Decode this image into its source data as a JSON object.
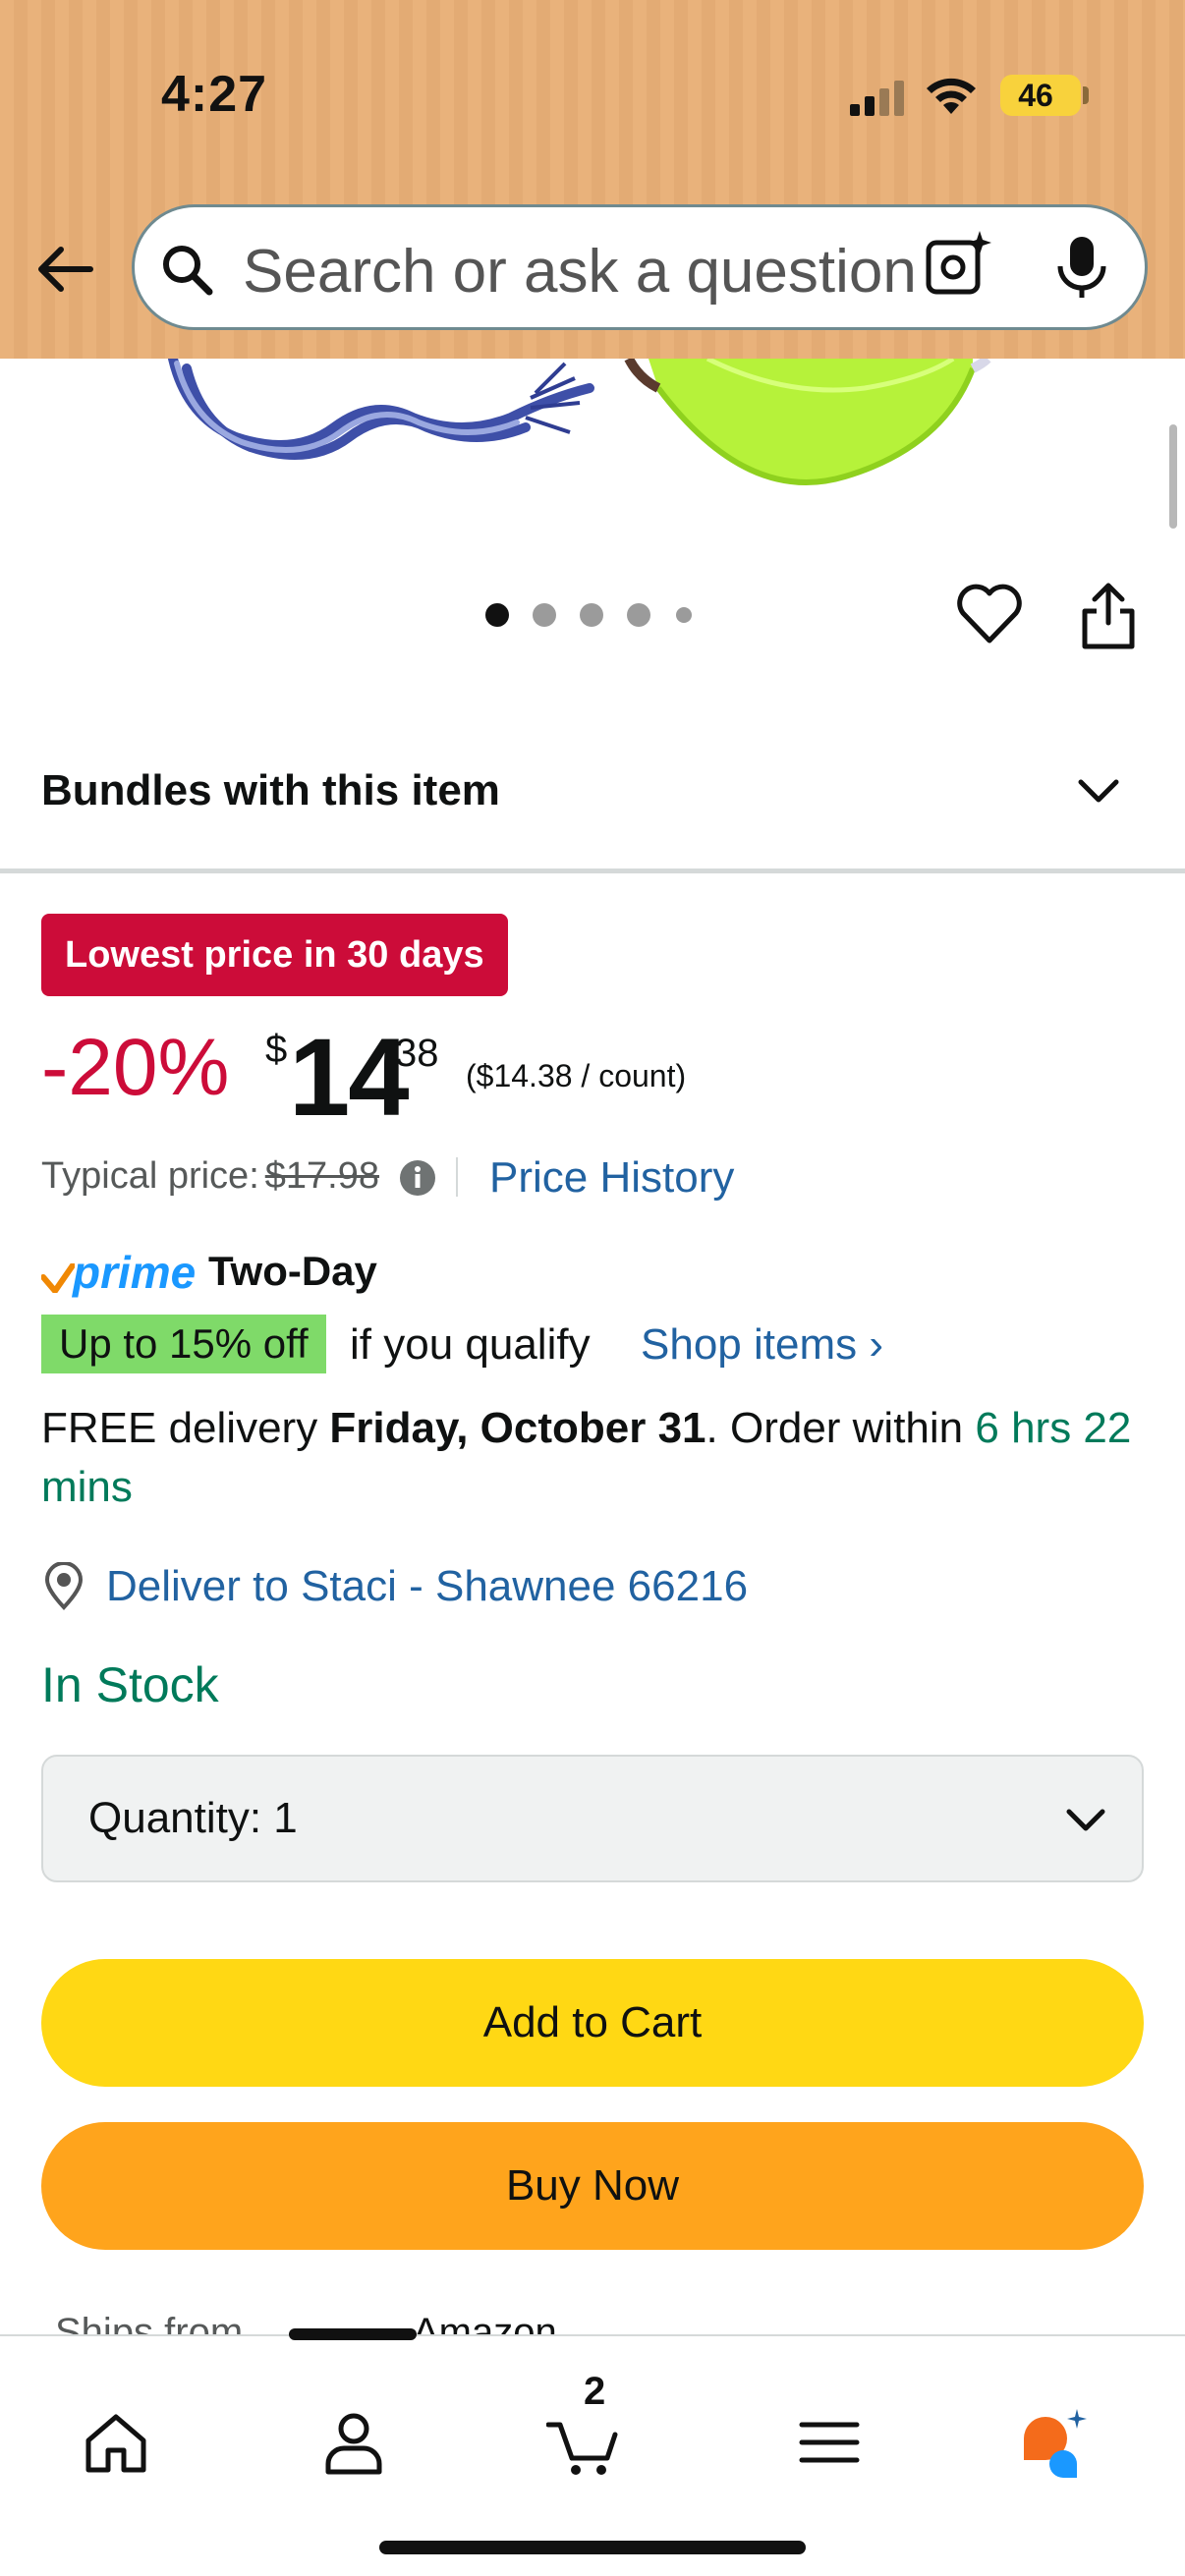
{
  "status_bar": {
    "time": "4:27",
    "battery": "46"
  },
  "search": {
    "placeholder": "Search or ask a question"
  },
  "product": {
    "bundles_label": "Bundles with this item",
    "deal_badge": "Lowest price in 30 days",
    "discount": "-20%",
    "currency": "$",
    "price_whole": "14",
    "price_fraction": "38",
    "unit_price": "($14.38 / count)",
    "typical_label": "Typical price:",
    "typical_value": "$17.98",
    "price_history": "Price History",
    "prime_logo": "prime",
    "prime_speed": "Two-Day",
    "offer_badge": "Up to 15% off",
    "offer_qualify": "if you qualify",
    "shop_items": "Shop items ›",
    "delivery_prefix": "FREE delivery ",
    "delivery_date": "Friday, October 31",
    "delivery_mid": ". Order within ",
    "delivery_countdown": "6 hrs 22 mins",
    "deliver_to": "Deliver to Staci - Shawnee 66216",
    "stock": "In Stock",
    "quantity_label": "Quantity:  1",
    "add_to_cart": "Add to Cart",
    "buy_now": "Buy Now",
    "ships_from_label": "Ships from",
    "ships_from_value": "Amazon"
  },
  "carousel": {
    "page_count": 5,
    "active_index": 0
  },
  "nav": {
    "cart_count": "2",
    "active_tab": "profile"
  },
  "colors": {
    "deal_red": "#cc0c39",
    "link_blue": "#2162a1",
    "stock_green": "#007a5a",
    "add_to_cart_yellow": "#ffd814",
    "buy_now_orange": "#ffa41c",
    "header_tan": "#e9b27b"
  },
  "icons": [
    "back-arrow-icon",
    "search-icon",
    "camera-lens-icon",
    "microphone-icon",
    "heart-icon",
    "share-icon",
    "chevron-down-icon",
    "info-icon",
    "location-pin-icon",
    "home-icon",
    "profile-icon",
    "cart-icon",
    "menu-icon",
    "rufus-ai-icon"
  ]
}
